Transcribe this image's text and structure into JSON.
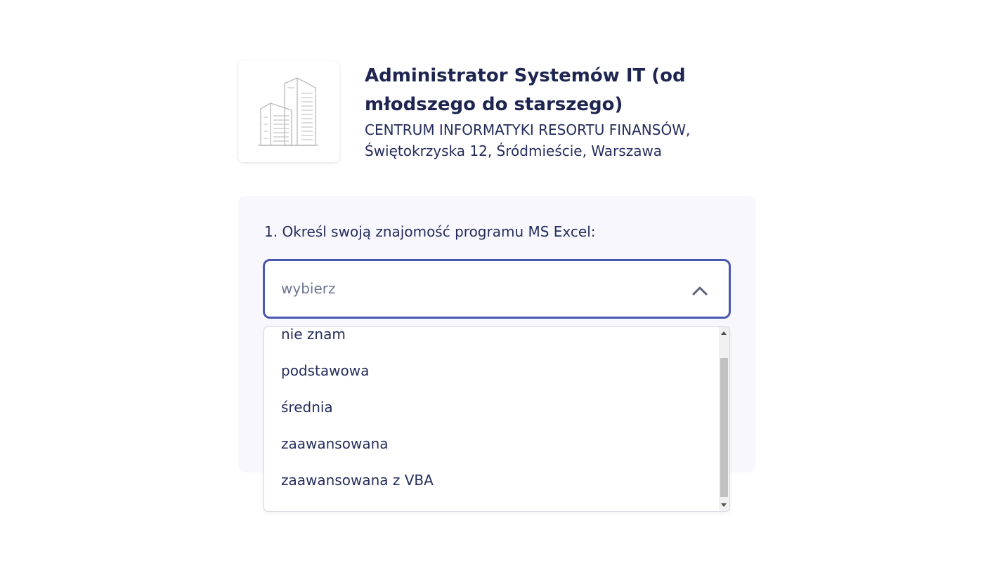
{
  "header": {
    "logo_icon": "office-building-icon",
    "job_title": "Administrator Systemów IT (od młodszego do starszego)",
    "company_line1": "CENTRUM INFORMATYKI RESORTU FINANSÓW,",
    "company_line2": "Świętokrzyska 12, Śródmieście, Warszawa"
  },
  "form": {
    "question": "1. Określ swoją znajomość programu MS Excel:",
    "select": {
      "placeholder": "wybierz",
      "icon": "chevron-up-icon",
      "options": [
        "nie znam",
        "podstawowa",
        "średnia",
        "zaawansowana",
        "zaawansowana z VBA"
      ]
    }
  },
  "colors": {
    "title": "#1e2550",
    "accent_border": "#4a57b0",
    "panel_bg": "#f7f7fd"
  }
}
